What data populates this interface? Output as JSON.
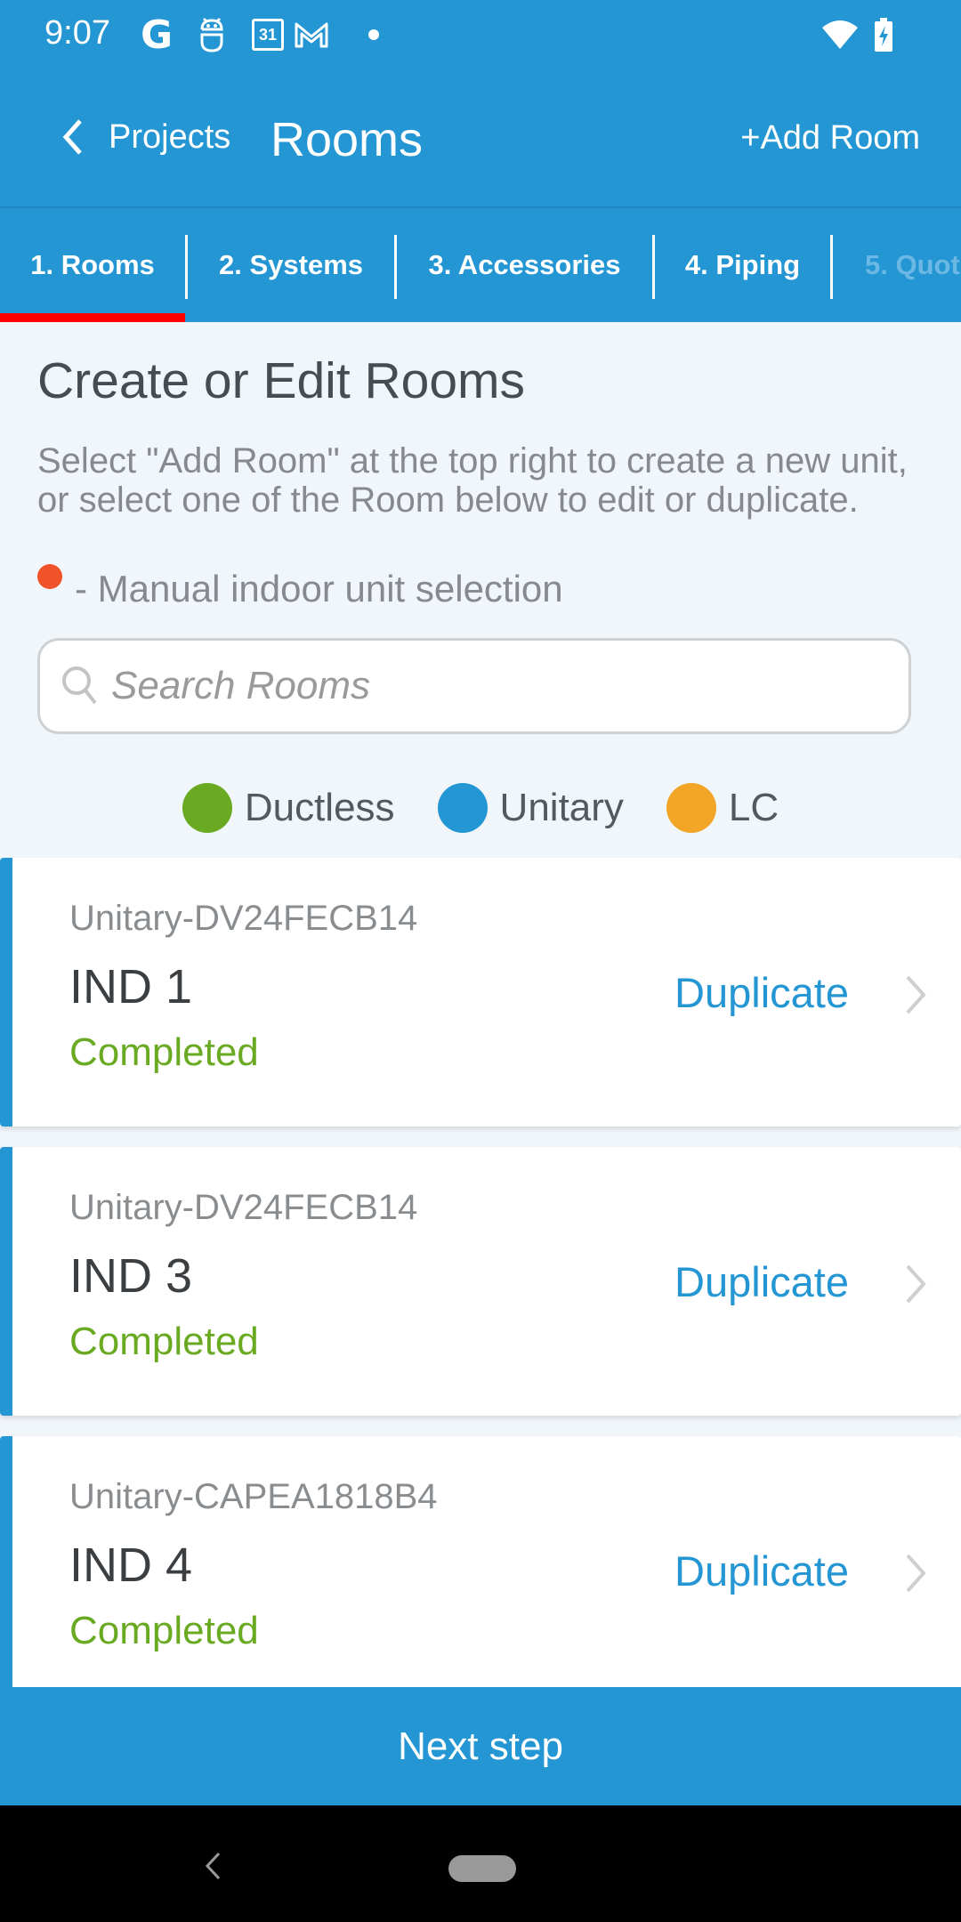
{
  "status_bar": {
    "time": "9:07",
    "icons": [
      "google-icon",
      "bot-icon",
      "calendar-icon",
      "gmail-icon",
      "notification-dot-icon",
      "wifi-icon",
      "battery-charging-icon"
    ],
    "calendar_day": "31",
    "google_glyph": "G"
  },
  "app_bar": {
    "back_label": "Projects",
    "title": "Rooms",
    "add_room_label": "+Add Room"
  },
  "tabs": [
    {
      "label": "1. Rooms",
      "active": true,
      "enabled": true
    },
    {
      "label": "2. Systems",
      "active": false,
      "enabled": true
    },
    {
      "label": "3. Accessories",
      "active": false,
      "enabled": true
    },
    {
      "label": "4. Piping",
      "active": false,
      "enabled": true
    },
    {
      "label": "5. Quot",
      "active": false,
      "enabled": false
    }
  ],
  "content": {
    "title": "Create or Edit Rooms",
    "description": "Select \"Add Room\" at the top right to create a new unit, or select one of the Room below to edit or duplicate.",
    "manual_indicator_text": "- Manual indoor unit selection",
    "manual_indicator_color": "#f0522a"
  },
  "search": {
    "placeholder": "Search Rooms",
    "value": ""
  },
  "legend": [
    {
      "label": "Ductless",
      "color": "#6aaa22"
    },
    {
      "label": "Unitary",
      "color": "#2396d3"
    },
    {
      "label": "LC",
      "color": "#f2a527"
    }
  ],
  "rooms": [
    {
      "model": "Unitary-DV24FECB14",
      "name": "IND 1",
      "status": "Completed",
      "action": "Duplicate"
    },
    {
      "model": "Unitary-DV24FECB14",
      "name": "IND 3",
      "status": "Completed",
      "action": "Duplicate"
    },
    {
      "model": "Unitary-CAPEA1818B4",
      "name": "IND 4",
      "status": "Completed",
      "action": "Duplicate"
    }
  ],
  "footer": {
    "next_label": "Next step"
  },
  "colors": {
    "primary": "#2396d3",
    "tab_active_underline": "#ff0000",
    "status_completed": "#6aaa22"
  }
}
